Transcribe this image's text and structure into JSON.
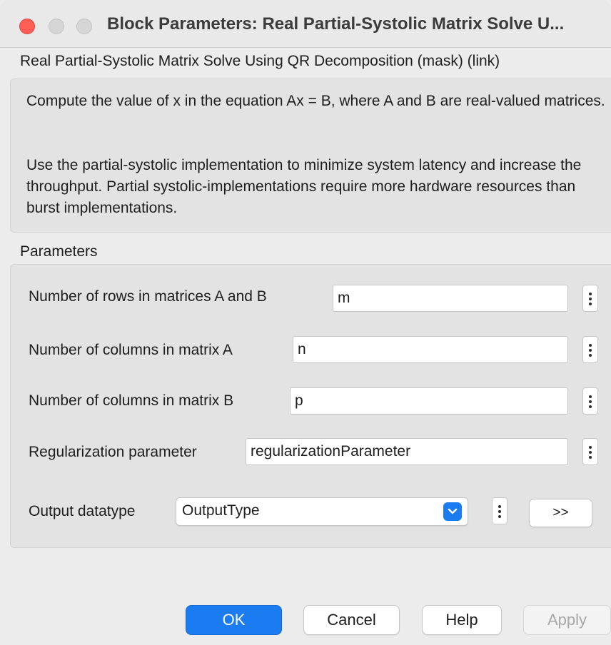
{
  "window": {
    "title": "Block Parameters: Real Partial-Systolic Matrix Solve U..."
  },
  "block": {
    "name": "Real Partial-Systolic Matrix Solve Using QR Decomposition (mask) (link)",
    "description_1": "Compute the value of x in the equation Ax = B, where A and B are real-valued matrices.",
    "description_2": "Use the partial-systolic implementation to minimize system latency and increase the throughput. Partial systolic-implementations require more hardware resources than burst implementations."
  },
  "parameters": {
    "section_label": "Parameters",
    "rows_label": "Number of rows in matrices A and B",
    "rows_value": "m",
    "cols_a_label": "Number of columns in matrix A",
    "cols_a_value": "n",
    "cols_b_label": "Number of columns in matrix B",
    "cols_b_value": "p",
    "reg_label": "Regularization parameter",
    "reg_value": "regularizationParameter",
    "output_label": "Output datatype",
    "output_value": "OutputType",
    "expand_label": ">>"
  },
  "buttons": {
    "ok": "OK",
    "cancel": "Cancel",
    "help": "Help",
    "apply": "Apply"
  },
  "colors": {
    "accent": "#1a7cf0",
    "close": "#ff5f57"
  }
}
